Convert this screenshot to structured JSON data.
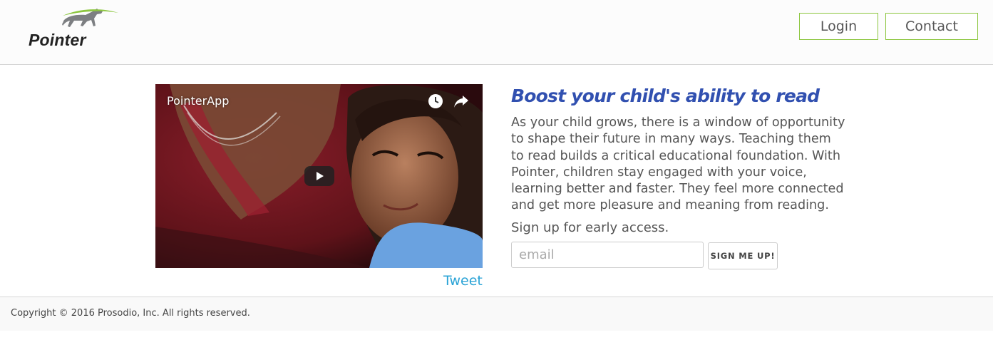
{
  "header": {
    "logo_text": "Pointer",
    "nav": {
      "login_label": "Login",
      "contact_label": "Contact"
    }
  },
  "video": {
    "title": "PointerApp",
    "icons": [
      "clock-icon",
      "share-icon",
      "play-icon"
    ]
  },
  "tweet_label": "Tweet",
  "main": {
    "headline": "Boost your child's ability to read",
    "paragraph": "As your child grows, there is a window of opportunity to shape their future in many ways. Teaching them to read builds a critical educational foundation. With Pointer, children stay engaged with your voice, learning better and faster. They feel more connected and get more pleasure and meaning from reading.",
    "signup_prompt": "Sign up for early access.",
    "email_placeholder": "email",
    "email_value": "",
    "signup_button": "SIGN ME UP!"
  },
  "footer": {
    "copyright": "Copyright © 2016 Prosodio, Inc. All rights reserved."
  },
  "colors": {
    "accent_green": "#8cc63f",
    "headline_blue": "#3150b0",
    "link_blue": "#2aa3d6"
  }
}
